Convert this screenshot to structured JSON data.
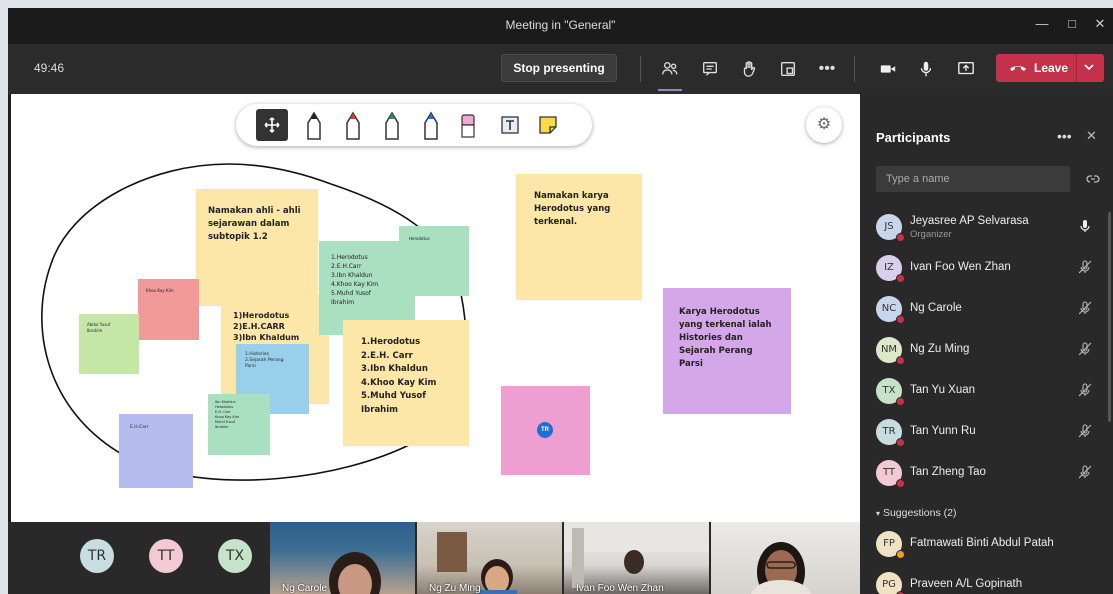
{
  "window": {
    "title": "Meeting in \"General\""
  },
  "toolbar": {
    "timer": "49:46",
    "stop_presenting": "Stop presenting",
    "leave": "Leave"
  },
  "notes": {
    "n1": "Namakan ahli - ahli\nsejarawan dalam\nsubtopik 1.2",
    "n2": "Namakan karya\nHerodotus yang\nterkenal.",
    "n3": "Karya Herodotus\nyang terkenal ialah\nHistories dan\nSejarah Perang\nParsi",
    "n4": "1.Herodotus\n2.E.H. Carr\n3.Ibn Khaldun\n4.Khoo Kay Kim\n5.Muhd Yusof\nIbrahim",
    "n5": "1)Herodotus\n2)E.H.CARR\n3)Ibn Khaldum",
    "n6": "1.Herodotus\n2.E.H.Carr\n3.Ibn Khaldun\n4.Khoo Kay Kim\n5.Muhd Yusof\nIbrahim",
    "n7": "Herodotus",
    "n8": "Khoo Kay Kim",
    "n9": "Abdul Yusuf\nIbrahim",
    "n10": "1.Histories\n2.Sejarah Perang\nParsi",
    "n11": "Ibn Khaldun\nHerodotus\nE.H. Carr\nKhoo Kay Kim\nMuhd Yusuf\nIbrahim",
    "n12": "E.H.Carr",
    "cursor_tag": "TR"
  },
  "strip": {
    "avatars": [
      {
        "initials": "TR",
        "color": "#c7dde0"
      },
      {
        "initials": "TT",
        "color": "#f3c9d4"
      },
      {
        "initials": "TX",
        "color": "#c6e3c9"
      }
    ],
    "tiles": [
      {
        "name": "Ng Carole"
      },
      {
        "name": "Ng Zu Ming"
      },
      {
        "name": "Ivan Foo Wen Zhan"
      },
      {
        "name": ""
      }
    ]
  },
  "panel": {
    "title": "Participants",
    "search_placeholder": "Type a name",
    "participants": [
      {
        "initials": "JS",
        "name": "Jeyasree AP Selvarasa",
        "role": "Organizer",
        "color": "#c7d6ea",
        "mic": "on"
      },
      {
        "initials": "IZ",
        "name": "Ivan Foo Wen Zhan",
        "role": "",
        "color": "#d7d0ea",
        "mic": "muted"
      },
      {
        "initials": "NC",
        "name": "Ng Carole",
        "role": "",
        "color": "#c7d6ea",
        "mic": "muted"
      },
      {
        "initials": "NM",
        "name": "Ng Zu Ming",
        "role": "",
        "color": "#dde7c9",
        "mic": "muted"
      },
      {
        "initials": "TX",
        "name": "Tan Yu Xuan",
        "role": "",
        "color": "#c6e3c9",
        "mic": "muted"
      },
      {
        "initials": "TR",
        "name": "Tan Yunn Ru",
        "role": "",
        "color": "#c7dde0",
        "mic": "muted"
      },
      {
        "initials": "TT",
        "name": "Tan Zheng Tao",
        "role": "",
        "color": "#f3c9d4",
        "mic": "muted"
      }
    ],
    "suggestions_header": "Suggestions (2)",
    "suggestions": [
      {
        "initials": "FP",
        "name": "Fatmawati Binti Abdul Patah",
        "color": "#efe3c4"
      },
      {
        "initials": "PG",
        "name": "Praveen A/L Gopinath",
        "color": "#efe3c4"
      }
    ]
  }
}
